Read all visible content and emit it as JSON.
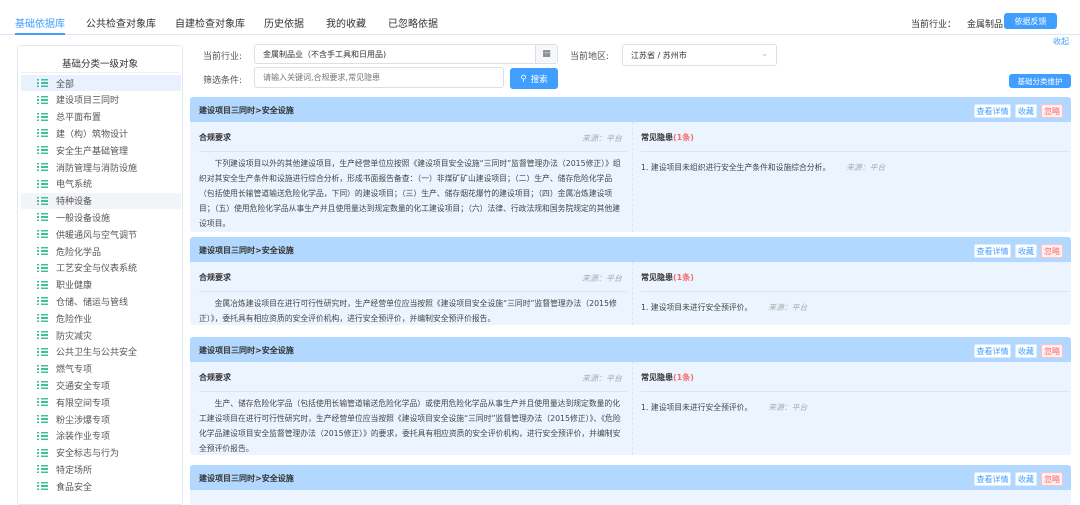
{
  "tabs": [
    "基础依据库",
    "公共检查对象库",
    "自建检查对象库",
    "历史依据",
    "我的收藏",
    "已忽略依据"
  ],
  "header": {
    "industry_label": "当前行业：",
    "industry_value": "金属制品...",
    "feedback_button": "依据反馈",
    "collapse_link": "收起"
  },
  "sidebar": {
    "title": "基础分类一级对象",
    "items": [
      "全部",
      "建设项目三同时",
      "总平面布置",
      "建（构）筑物设计",
      "安全生产基础管理",
      "消防管理与消防设施",
      "电气系统",
      "特种设备",
      "一般设备设施",
      "供暖通风与空气调节",
      "危险化学品",
      "工艺安全与仪表系统",
      "职业健康",
      "仓储、储运与管线",
      "危险作业",
      "防灾减灾",
      "公共卫生与公共安全",
      "燃气专项",
      "交通安全专项",
      "有限空间专项",
      "粉尘涉爆专项",
      "涂装作业专项",
      "安全标志与行为",
      "特定场所",
      "食品安全"
    ]
  },
  "filters": {
    "industry_label": "当前行业:",
    "industry_value": "金属制品业（不含手工具和日用品)",
    "region_label": "当前地区:",
    "region_value": "江苏省 / 苏州市",
    "condition_label": "筛选条件:",
    "search_placeholder": "请输入关键词,合规要求,常见隐患",
    "search_button": "搜索",
    "maintain_button": "基础分类维护"
  },
  "card_labels": {
    "compliance": "合规要求",
    "source": "来源：平台",
    "hazards": "常见隐患",
    "detail": "查看详情",
    "favorite": "收藏",
    "ignore": "忽略"
  },
  "cards": [
    {
      "title": "建设项目三同时>安全设施",
      "text": "下列建设项目以外的其他建设项目，生产经营单位应按照《建设项目安全设施“三同时”监督管理办法（2015修正）》组织对其安全生产条件和设施进行综合分析，形成书面报告备查：（一）非煤矿矿山建设项目；（二）生产、储存危险化学品（包括使用长输管道输送危险化学品，下同）的建设项目；（三）生产、储存烟花爆竹的建设项目；（四）金属冶炼建设项目；（五）使用危险化学品从事生产并且使用量达到规定数量的化工建设项目；（六）法律、行政法规和国务院规定的其他建设项目。",
      "hazard_count": "(1条)",
      "hazard": "1. 建设项目未组织进行安全生产条件和设施综合分析。"
    },
    {
      "title": "建设项目三同时>安全设施",
      "text": "金属冶炼建设项目在进行可行性研究时，生产经营单位应当按照《建设项目安全设施“三同时”监督管理办法（2015修正）》，委托具有相应资质的安全评价机构，进行安全预评价，并编制安全预评价报告。",
      "hazard_count": "(1条)",
      "hazard": "1. 建设项目未进行安全预评价。"
    },
    {
      "title": "建设项目三同时>安全设施",
      "text": "生产、储存危险化学品（包括使用长输管道输送危险化学品）或使用危险化学品从事生产并且使用量达到规定数量的化工建设项目在进行可行性研究时，生产经营单位应当按照《建设项目安全设施“三同时”监督管理办法（2015修正）》、《危险化学品建设项目安全监督管理办法（2015修正）》的要求，委托具有相应资质的安全评价机构，进行安全预评价，并编制安全预评价报告。",
      "hazard_count": "(1条)",
      "hazard": "1. 建设项目未进行安全预评价。"
    },
    {
      "title": "建设项目三同时>安全设施"
    }
  ],
  "colors": {
    "primary": "#409eff",
    "header": "#b3d8ff",
    "card_bg": "#ecf5ff",
    "danger": "#f56c6c",
    "icon": "#3fc09a"
  }
}
